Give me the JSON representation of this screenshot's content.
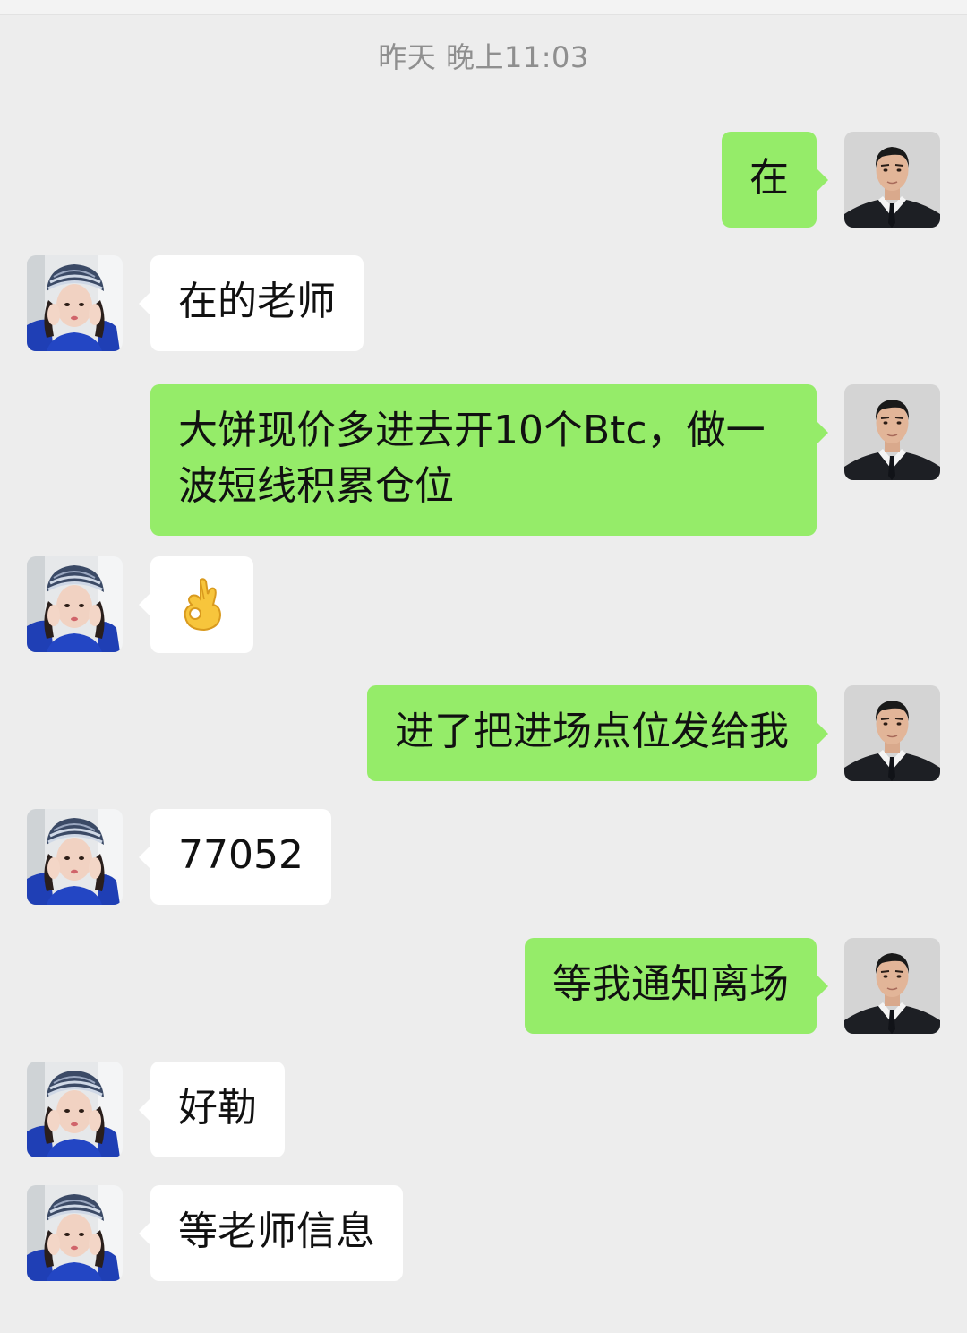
{
  "header": {
    "timestamp": "昨天 晚上11:03"
  },
  "messages": [
    {
      "side": "out",
      "text": "在"
    },
    {
      "side": "in",
      "text": "在的老师"
    },
    {
      "side": "out",
      "text": "大饼现价多进去开10个Btc，做一波短线积累仓位"
    },
    {
      "side": "in",
      "emoji": "ok-hand-icon"
    },
    {
      "side": "out",
      "text": "进了把进场点位发给我"
    },
    {
      "side": "in",
      "text": "77052"
    },
    {
      "side": "out",
      "text": "等我通知离场"
    },
    {
      "side": "in",
      "text": "好勒"
    },
    {
      "side": "in",
      "text": "等老师信息"
    }
  ],
  "colors": {
    "background": "#ededed",
    "outgoing_bubble": "#95ec69",
    "incoming_bubble": "#ffffff",
    "timestamp_text": "#8f8f8f"
  }
}
